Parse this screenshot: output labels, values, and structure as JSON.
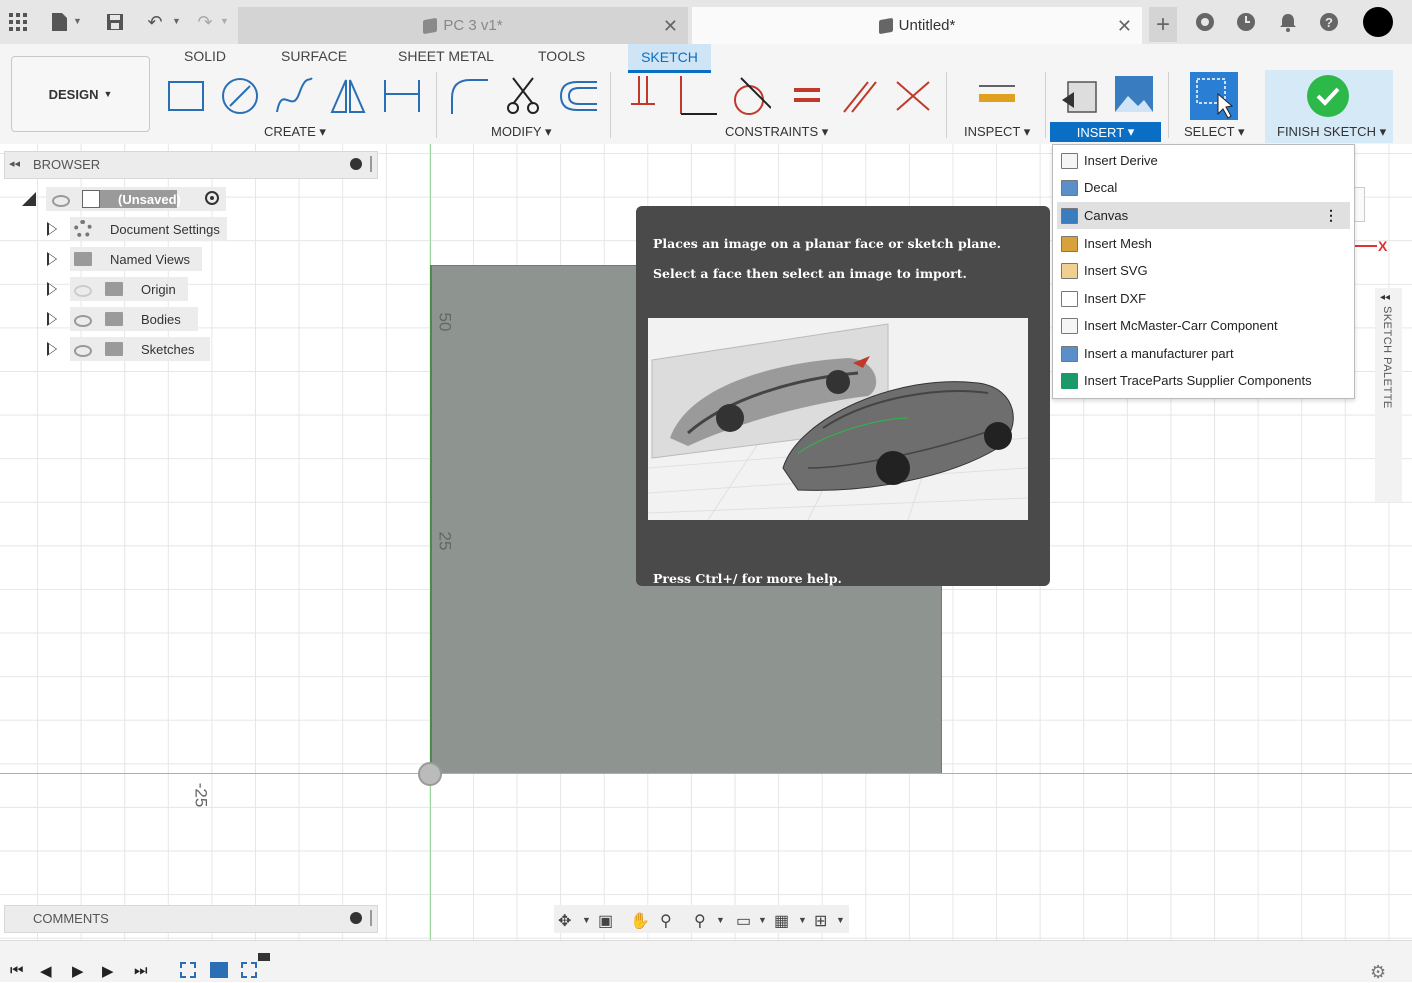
{
  "tabs": [
    {
      "label": "PC 3 v1*",
      "active": false
    },
    {
      "label": "Untitled*",
      "active": true
    }
  ],
  "ribbon": {
    "tabs": [
      "SOLID",
      "SURFACE",
      "SHEET METAL",
      "TOOLS",
      "SKETCH"
    ],
    "active_tab": "SKETCH",
    "workspace": "DESIGN",
    "groups": [
      "CREATE",
      "MODIFY",
      "CONSTRAINTS",
      "INSPECT",
      "INSERT",
      "SELECT",
      "FINISH SKETCH"
    ]
  },
  "browser": {
    "title": "BROWSER",
    "root": "(Unsaved)",
    "items": [
      "Document Settings",
      "Named Views",
      "Origin",
      "Bodies",
      "Sketches"
    ]
  },
  "comments": {
    "title": "COMMENTS"
  },
  "canvas": {
    "dimensions": [
      "50",
      "25",
      "-25"
    ],
    "axis_label": "X"
  },
  "tooltip": {
    "line1": "Places an image on a planar face or sketch plane.",
    "line2": "Select a face then select an image to import.",
    "footer": "Press Ctrl+/ for more help."
  },
  "insert_menu": {
    "items": [
      "Insert Derive",
      "Decal",
      "Canvas",
      "Insert Mesh",
      "Insert SVG",
      "Insert DXF",
      "Insert McMaster-Carr Component",
      "Insert a manufacturer part",
      "Insert TraceParts Supplier Components"
    ],
    "highlighted": "Canvas"
  },
  "sketch_palette": {
    "label": "SKETCH PALETTE"
  },
  "colors": {
    "accent": "#0a6ec4",
    "finish_check": "#2db84a",
    "sketch_fill": "#8e9591",
    "tooltip_bg": "#4a4a4a"
  }
}
